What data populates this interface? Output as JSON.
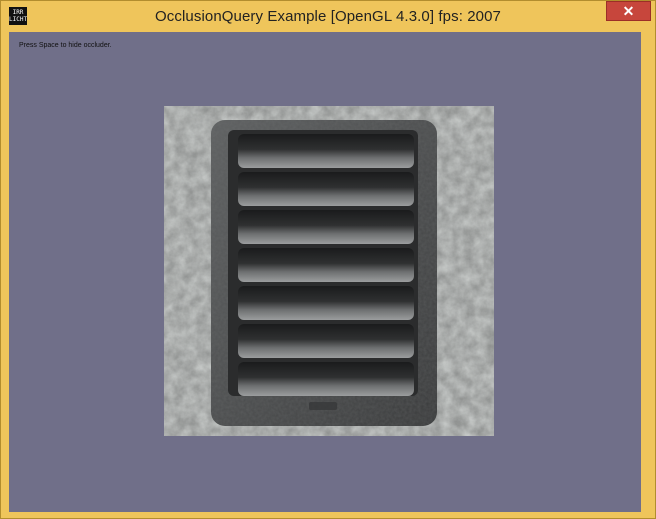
{
  "window": {
    "title": "OcclusionQuery Example [OpenGL 4.3.0] fps: 2007",
    "icon": "app-logo-icon",
    "close_symbol": "✕"
  },
  "app_icon_text": {
    "line1": "IRR",
    "line2": "LICHT"
  },
  "scene": {
    "hint_text": "Press Space to hide occluder.",
    "background_color": "#706f89",
    "object": "vent-grate-occluder"
  }
}
